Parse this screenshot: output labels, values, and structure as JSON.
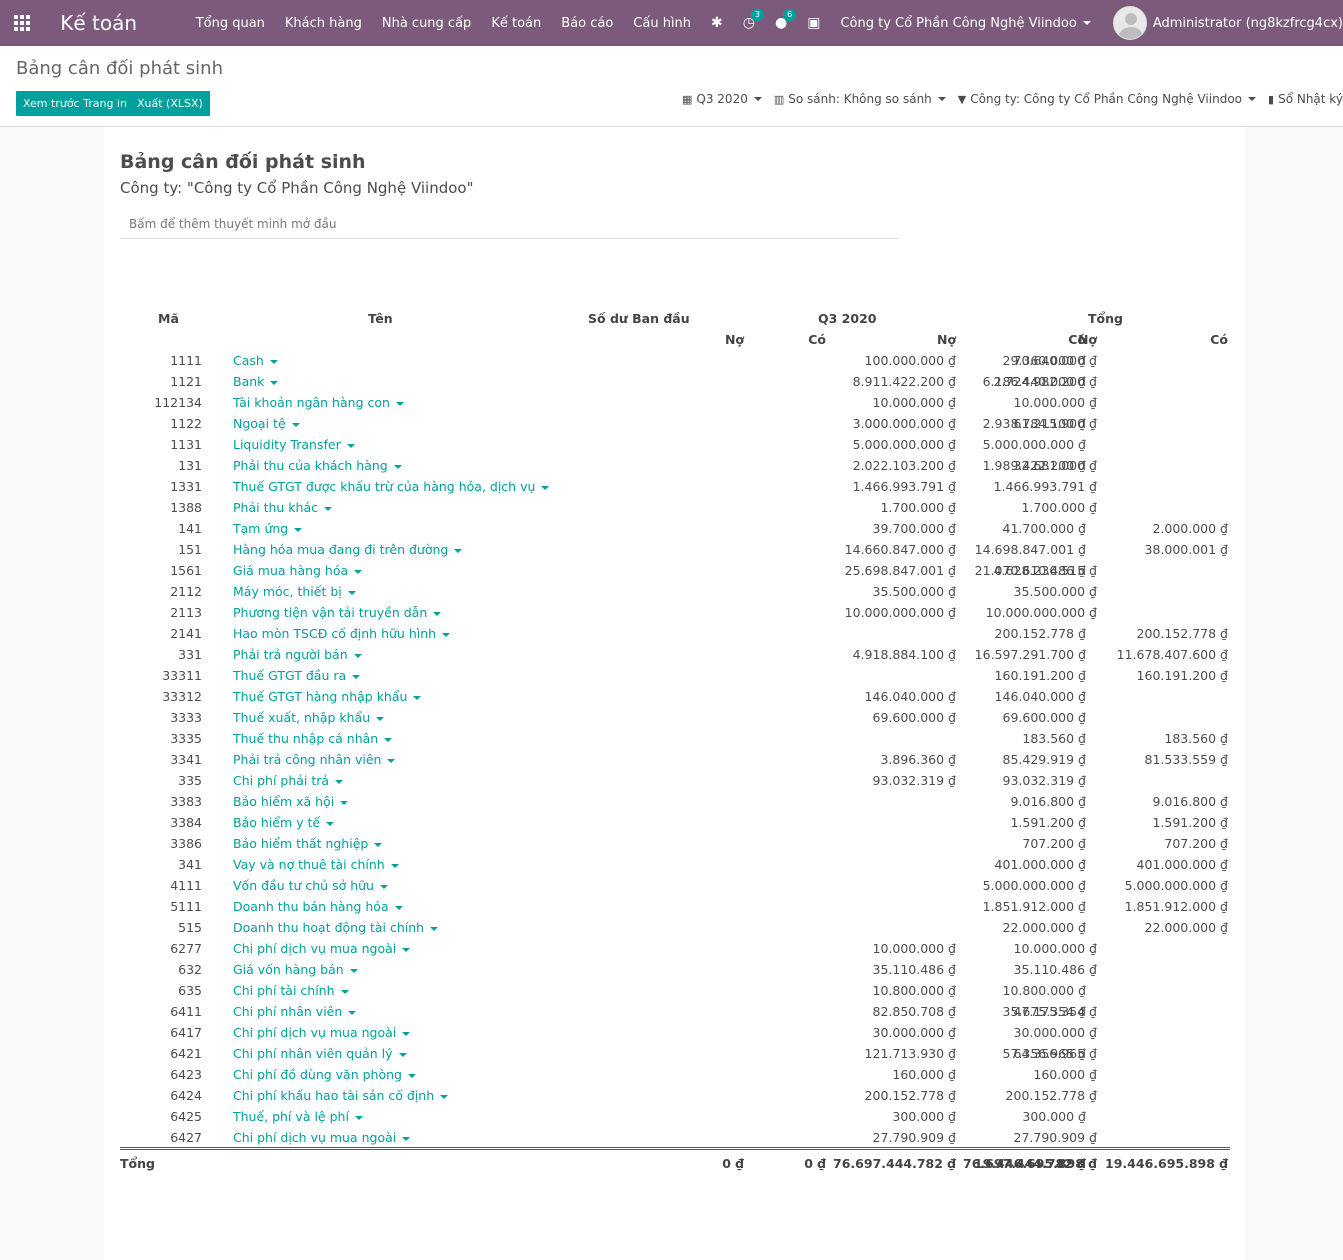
{
  "app": {
    "title": "Kế toán"
  },
  "menu": [
    "Tổng quan",
    "Khách hàng",
    "Nhà cung cấp",
    "Kế toán",
    "Báo cáo",
    "Cấu hình"
  ],
  "systray": {
    "activity_count": "3",
    "message_count": "6",
    "company": "Công ty Cổ Phần Công Nghệ Viindoo",
    "user": "Administrator (ng8kzfrcg4cx)"
  },
  "breadcrumb": "Bảng cân đối phát sinh",
  "buttons": {
    "print_preview": "Xem trước Trang in",
    "export_xlsx": "Xuất (XLSX)"
  },
  "filters": {
    "period": "Q3 2020",
    "comparison": "So sánh: Không so sánh",
    "company": "Công ty: Công ty Cổ Phần Công Nghệ Viindoo",
    "journals": "Sổ Nhật ký: Tất cả"
  },
  "report": {
    "title": "Bảng cân đối phát sinh",
    "company": "Công ty: \"Công ty Cổ Phần Công Nghệ Viindoo\"",
    "note_placeholder": "Bấm để thêm thuyết minh mở đầu",
    "headers": {
      "code": "Mã",
      "name": "Tên",
      "initial": "Số dư Ban đầu",
      "period": "Q3 2020",
      "total": "Tổng",
      "debit": "Nợ",
      "credit": "Có"
    },
    "rows": [
      {
        "code": "1111",
        "name": "Cash",
        "n1": "",
        "c1": "",
        "n2": "100.000.000 ₫",
        "c2": "29.360.000 ₫",
        "n3": "70.640.000 ₫",
        "c3": ""
      },
      {
        "code": "1121",
        "name": "Bank",
        "n1": "",
        "c1": "",
        "n2": "8.911.422.200 ₫",
        "c2": "6.186.440.000 ₫",
        "n3": "2.724.982.200 ₫",
        "c3": ""
      },
      {
        "code": "112134",
        "name": "Tài khoản ngân hàng con",
        "n1": "",
        "c1": "",
        "n2": "10.000.000 ₫",
        "c2": "",
        "n3": "10.000.000 ₫",
        "c3": ""
      },
      {
        "code": "1122",
        "name": "Ngoại tệ",
        "n1": "",
        "c1": "",
        "n2": "3.000.000.000 ₫",
        "c2": "2.938.784.100 ₫",
        "n3": "61.215.900 ₫",
        "c3": ""
      },
      {
        "code": "1131",
        "name": "Liquidity Transfer",
        "n1": "",
        "c1": "",
        "n2": "5.000.000.000 ₫",
        "c2": "5.000.000.000 ₫",
        "n3": "",
        "c3": ""
      },
      {
        "code": "131",
        "name": "Phải thu của khách hàng",
        "n1": "",
        "c1": "",
        "n2": "2.022.103.200 ₫",
        "c2": "1.989.422.200 ₫",
        "n3": "32.681.000 ₫",
        "c3": ""
      },
      {
        "code": "1331",
        "name": "Thuế GTGT được khấu trừ của hàng hóa, dịch vụ",
        "n1": "",
        "c1": "",
        "n2": "1.466.993.791 ₫",
        "c2": "",
        "n3": "1.466.993.791 ₫",
        "c3": ""
      },
      {
        "code": "1388",
        "name": "Phải thu khác",
        "n1": "",
        "c1": "",
        "n2": "1.700.000 ₫",
        "c2": "",
        "n3": "1.700.000 ₫",
        "c3": ""
      },
      {
        "code": "141",
        "name": "Tạm ứng",
        "n1": "",
        "c1": "",
        "n2": "39.700.000 ₫",
        "c2": "41.700.000 ₫",
        "n3": "",
        "c3": "2.000.000 ₫"
      },
      {
        "code": "151",
        "name": "Hàng hóa mua đang đi trên đường",
        "n1": "",
        "c1": "",
        "n2": "14.660.847.000 ₫",
        "c2": "14.698.847.001 ₫",
        "n3": "",
        "c3": "38.000.001 ₫"
      },
      {
        "code": "1561",
        "name": "Giá mua hàng hóa",
        "n1": "",
        "c1": "",
        "n2": "25.698.847.001 ₫",
        "c2": "21.070.610.486 ₫",
        "n3": "4.628.236.515 ₫",
        "c3": ""
      },
      {
        "code": "2112",
        "name": "Máy móc, thiết bị",
        "n1": "",
        "c1": "",
        "n2": "35.500.000 ₫",
        "c2": "",
        "n3": "35.500.000 ₫",
        "c3": ""
      },
      {
        "code": "2113",
        "name": "Phương tiện vận tải truyền dẫn",
        "n1": "",
        "c1": "",
        "n2": "10.000.000.000 ₫",
        "c2": "",
        "n3": "10.000.000.000 ₫",
        "c3": ""
      },
      {
        "code": "2141",
        "name": "Hao mòn TSCĐ cố định hữu hình",
        "n1": "",
        "c1": "",
        "n2": "",
        "c2": "200.152.778 ₫",
        "n3": "",
        "c3": "200.152.778 ₫"
      },
      {
        "code": "331",
        "name": "Phải trả người bán",
        "n1": "",
        "c1": "",
        "n2": "4.918.884.100 ₫",
        "c2": "16.597.291.700 ₫",
        "n3": "",
        "c3": "11.678.407.600 ₫"
      },
      {
        "code": "33311",
        "name": "Thuế GTGT đầu ra",
        "n1": "",
        "c1": "",
        "n2": "",
        "c2": "160.191.200 ₫",
        "n3": "",
        "c3": "160.191.200 ₫"
      },
      {
        "code": "33312",
        "name": "Thuế GTGT hàng nhập khẩu",
        "n1": "",
        "c1": "",
        "n2": "146.040.000 ₫",
        "c2": "146.040.000 ₫",
        "n3": "",
        "c3": ""
      },
      {
        "code": "3333",
        "name": "Thuế xuất, nhập khẩu",
        "n1": "",
        "c1": "",
        "n2": "69.600.000 ₫",
        "c2": "69.600.000 ₫",
        "n3": "",
        "c3": ""
      },
      {
        "code": "3335",
        "name": "Thuế thu nhập cá nhân",
        "n1": "",
        "c1": "",
        "n2": "",
        "c2": "183.560 ₫",
        "n3": "",
        "c3": "183.560 ₫"
      },
      {
        "code": "3341",
        "name": "Phải trả công nhân viên",
        "n1": "",
        "c1": "",
        "n2": "3.896.360 ₫",
        "c2": "85.429.919 ₫",
        "n3": "",
        "c3": "81.533.559 ₫"
      },
      {
        "code": "335",
        "name": "Chi phí phải trả",
        "n1": "",
        "c1": "",
        "n2": "93.032.319 ₫",
        "c2": "93.032.319 ₫",
        "n3": "",
        "c3": ""
      },
      {
        "code": "3383",
        "name": "Bảo hiểm xã hội",
        "n1": "",
        "c1": "",
        "n2": "",
        "c2": "9.016.800 ₫",
        "n3": "",
        "c3": "9.016.800 ₫"
      },
      {
        "code": "3384",
        "name": "Bảo hiểm y tế",
        "n1": "",
        "c1": "",
        "n2": "",
        "c2": "1.591.200 ₫",
        "n3": "",
        "c3": "1.591.200 ₫"
      },
      {
        "code": "3386",
        "name": "Bảo hiểm thất nghiệp",
        "n1": "",
        "c1": "",
        "n2": "",
        "c2": "707.200 ₫",
        "n3": "",
        "c3": "707.200 ₫"
      },
      {
        "code": "341",
        "name": "Vay và nợ thuê tài chính",
        "n1": "",
        "c1": "",
        "n2": "",
        "c2": "401.000.000 ₫",
        "n3": "",
        "c3": "401.000.000 ₫"
      },
      {
        "code": "4111",
        "name": "Vốn đầu tư chủ sở hữu",
        "n1": "",
        "c1": "",
        "n2": "",
        "c2": "5.000.000.000 ₫",
        "n3": "",
        "c3": "5.000.000.000 ₫"
      },
      {
        "code": "5111",
        "name": "Doanh thu bán hàng hóa",
        "n1": "",
        "c1": "",
        "n2": "",
        "c2": "1.851.912.000 ₫",
        "n3": "",
        "c3": "1.851.912.000 ₫"
      },
      {
        "code": "515",
        "name": "Doanh thu hoạt động tài chính",
        "n1": "",
        "c1": "",
        "n2": "",
        "c2": "22.000.000 ₫",
        "n3": "",
        "c3": "22.000.000 ₫"
      },
      {
        "code": "6277",
        "name": "Chi phí dịch vụ mua ngoài",
        "n1": "",
        "c1": "",
        "n2": "10.000.000 ₫",
        "c2": "",
        "n3": "10.000.000 ₫",
        "c3": ""
      },
      {
        "code": "632",
        "name": "Giá vốn hàng bán",
        "n1": "",
        "c1": "",
        "n2": "35.110.486 ₫",
        "c2": "",
        "n3": "35.110.486 ₫",
        "c3": ""
      },
      {
        "code": "635",
        "name": "Chi phí tài chính",
        "n1": "",
        "c1": "",
        "n2": "10.800.000 ₫",
        "c2": "10.800.000 ₫",
        "n3": "",
        "c3": ""
      },
      {
        "code": "6411",
        "name": "Chi phí nhân viên",
        "n1": "",
        "c1": "",
        "n2": "82.850.708 ₫",
        "c2": "35.675.354 ₫",
        "n3": "47.175.354 ₫",
        "c3": ""
      },
      {
        "code": "6417",
        "name": "Chi phí dịch vụ mua ngoài",
        "n1": "",
        "c1": "",
        "n2": "30.000.000 ₫",
        "c2": "",
        "n3": "30.000.000 ₫",
        "c3": ""
      },
      {
        "code": "6421",
        "name": "Chi phí nhân viên quản lý",
        "n1": "",
        "c1": "",
        "n2": "121.713.930 ₫",
        "c2": "57.356.965 ₫",
        "n3": "64.356.965 ₫",
        "c3": ""
      },
      {
        "code": "6423",
        "name": "Chi phí đồ dùng văn phòng",
        "n1": "",
        "c1": "",
        "n2": "160.000 ₫",
        "c2": "",
        "n3": "160.000 ₫",
        "c3": ""
      },
      {
        "code": "6424",
        "name": "Chi phí khấu hao tài sản cố định",
        "n1": "",
        "c1": "",
        "n2": "200.152.778 ₫",
        "c2": "",
        "n3": "200.152.778 ₫",
        "c3": ""
      },
      {
        "code": "6425",
        "name": "Thuế, phí và lệ phí",
        "n1": "",
        "c1": "",
        "n2": "300.000 ₫",
        "c2": "300.000 ₫",
        "n3": "",
        "c3": ""
      },
      {
        "code": "6427",
        "name": "Chi phí dịch vụ mua ngoài",
        "n1": "",
        "c1": "",
        "n2": "27.790.909 ₫",
        "c2": "",
        "n3": "27.790.909 ₫",
        "c3": ""
      }
    ],
    "total": {
      "label": "Tổng",
      "n1": "0 ₫",
      "c1": "0 ₫",
      "n2": "76.697.444.782 ₫",
      "c2": "76.697.444.782 ₫",
      "n3": "19.446.695.898 ₫",
      "c3": "19.446.695.898 ₫"
    }
  }
}
